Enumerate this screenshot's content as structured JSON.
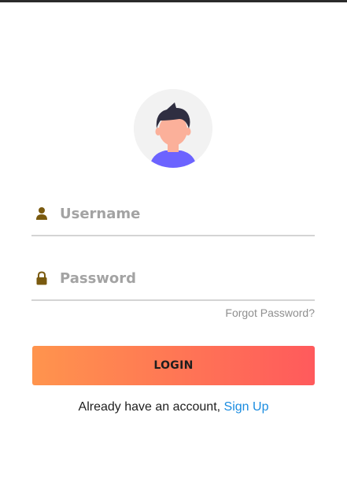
{
  "form": {
    "username_placeholder": "Username",
    "password_placeholder": "Password",
    "forgot_label": "Forgot Password?",
    "login_label": "LOGIN",
    "signup_prompt": "Already have an account,",
    "signup_link": "Sign Up"
  },
  "icons": {
    "avatar": "user-avatar-icon",
    "username": "user-icon",
    "password": "lock-icon"
  },
  "colors": {
    "icon": "#7a5a0f",
    "gradient_start": "#ff944d",
    "gradient_end": "#ff5a5c",
    "link": "#1a8ce0",
    "placeholder": "#a3a3a3",
    "avatar_shirt": "#6c63ff",
    "avatar_skin": "#fbb09a",
    "avatar_hair": "#2f2e41"
  }
}
